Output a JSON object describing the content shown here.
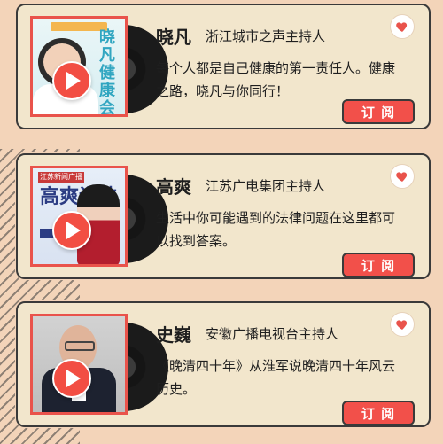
{
  "cards": [
    {
      "host_name": "晓凡",
      "host_title": "浙江城市之声主持人",
      "description": "每个人都是自己健康的第一责任人。健康之路，晓凡与你同行！",
      "subscribe_label": "订 阅",
      "cover_text": "晓凡健康会所"
    },
    {
      "host_name": "高爽",
      "host_title": "江苏广电集团主持人",
      "description": "生活中你可能遇到的法律问题在这里都可以找到答案。",
      "subscribe_label": "订 阅",
      "cover_label": "江苏新闻广播",
      "cover_text": "高爽说法"
    },
    {
      "host_name": "史巍",
      "host_title": "安徽广播电视台主持人",
      "description": "《晚清四十年》从淮军说晚清四十年风云历史。",
      "subscribe_label": "订 阅"
    }
  ],
  "icons": {
    "favorite": "heart-icon",
    "play": "play-icon"
  },
  "colors": {
    "accent_red": "#F2504A",
    "background": "#F3D4B9",
    "card": "#F2E6CC"
  }
}
